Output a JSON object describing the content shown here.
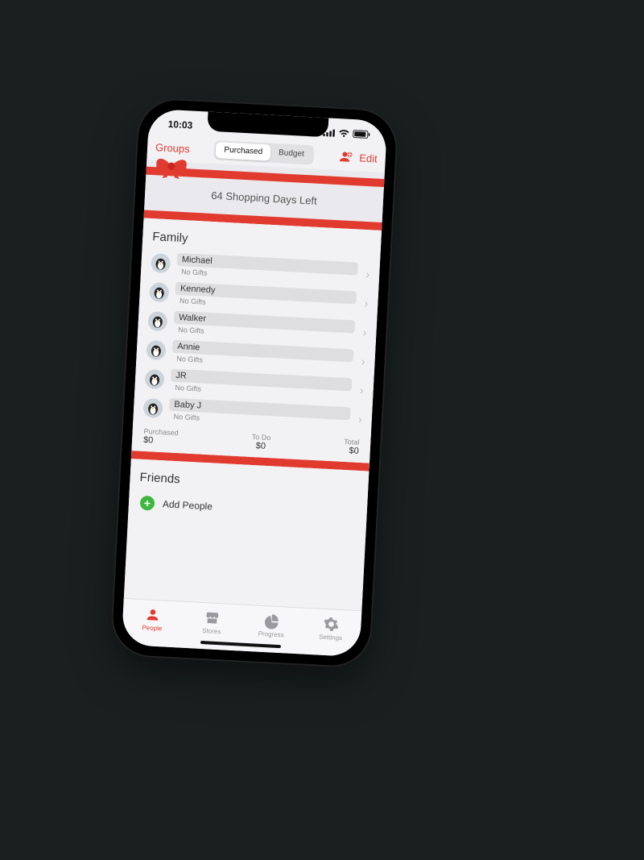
{
  "status": {
    "time": "10:03"
  },
  "nav": {
    "groups": "Groups",
    "segments": {
      "purchased": "Purchased",
      "budget": "Budget",
      "active": "purchased"
    },
    "edit": "Edit"
  },
  "banner": {
    "text": "64 Shopping Days Left"
  },
  "sections": [
    {
      "title": "Family",
      "people": [
        {
          "name": "Michael",
          "sub": "No Gifts"
        },
        {
          "name": "Kennedy",
          "sub": "No Gifts"
        },
        {
          "name": "Walker",
          "sub": "No Gifts"
        },
        {
          "name": "Annie",
          "sub": "No Gifts"
        },
        {
          "name": "JR",
          "sub": "No Gifts"
        },
        {
          "name": "Baby J",
          "sub": "No Gifts"
        }
      ],
      "summary": {
        "purchased_label": "Purchased",
        "purchased_val": "$0",
        "todo_label": "To Do",
        "todo_val": "$0",
        "total_label": "Total",
        "total_val": "$0"
      }
    },
    {
      "title": "Friends",
      "add_label": "Add People"
    }
  ],
  "tabs": {
    "people": "People",
    "stores": "Stores",
    "progress": "Progress",
    "settings": "Settings",
    "active": "people"
  },
  "colors": {
    "accent": "#e13b30",
    "green": "#3fb63f"
  }
}
